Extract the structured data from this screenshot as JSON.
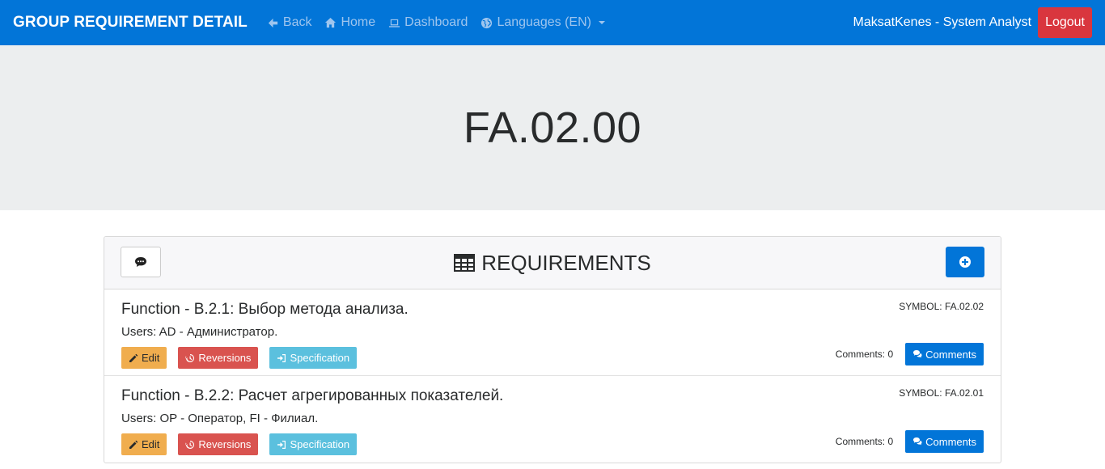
{
  "navbar": {
    "brand": "GROUP REQUIREMENT DETAIL",
    "links": [
      {
        "label": "Back",
        "icon": "arrow-left-icon"
      },
      {
        "label": "Home",
        "icon": "home-icon"
      },
      {
        "label": "Dashboard",
        "icon": "laptop-icon"
      },
      {
        "label": "Languages (EN)",
        "icon": "globe-icon"
      }
    ],
    "user": "MaksatKenes - System Analyst",
    "logout": "Logout"
  },
  "jumbotron": {
    "title": "FA.02.00"
  },
  "card": {
    "header_title": "REQUIREMENTS",
    "items": [
      {
        "title": "Function - B.2.1: Выбор метода анализа.",
        "users": "Users: AD - Администратор.",
        "symbol": "SYMBOL: FA.02.02",
        "edit": "Edit",
        "reversions": "Reversions",
        "specification": "Specification",
        "comments_count": "Comments: 0",
        "comments_button": "Comments"
      },
      {
        "title": "Function - B.2.2: Расчет агрегированных показателей.",
        "users": "Users: OP - Оператор, FI - Филиал.",
        "symbol": "SYMBOL: FA.02.01",
        "edit": "Edit",
        "reversions": "Reversions",
        "specification": "Specification",
        "comments_count": "Comments: 0",
        "comments_button": "Comments"
      }
    ]
  },
  "colors": {
    "navbar": "#0275d8",
    "logout": "#d9363e",
    "edit": "#f0ad4e",
    "reversions": "#d9534f",
    "specification": "#5bc0de",
    "primary": "#0275d8"
  }
}
